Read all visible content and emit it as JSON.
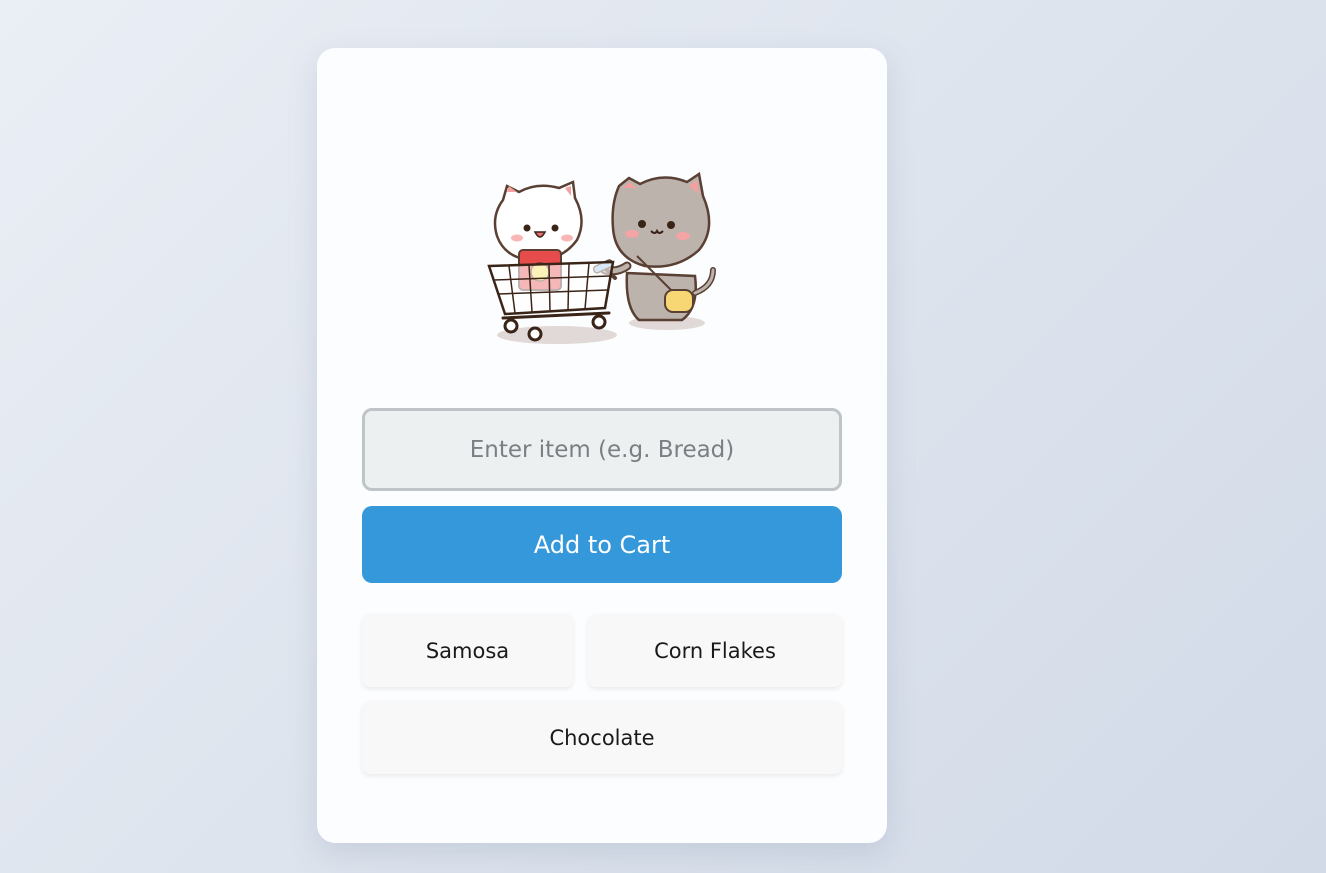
{
  "cart": {
    "input_placeholder": "Enter item (e.g. Bread)",
    "input_value": "",
    "add_button_label": "Add to Cart",
    "accent_color": "#3498db"
  },
  "items": [
    {
      "label": "Samosa"
    },
    {
      "label": "Corn Flakes"
    },
    {
      "label": "Chocolate"
    }
  ],
  "illustration": {
    "icon": "cats-shopping-cart-illustration"
  }
}
